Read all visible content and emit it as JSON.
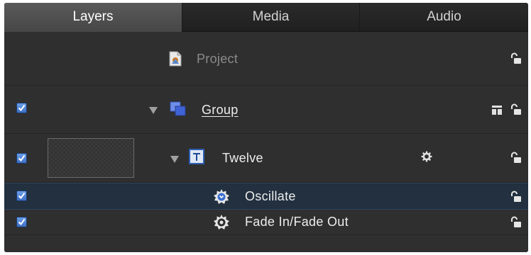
{
  "tabs": [
    {
      "label": "Layers",
      "active": true
    },
    {
      "label": "Media",
      "active": false
    },
    {
      "label": "Audio",
      "active": false
    }
  ],
  "layers": {
    "project": {
      "label": "Project",
      "icon": "project-file-icon",
      "locked": false
    },
    "group": {
      "label": "Group",
      "checked": true,
      "expanded": true,
      "icon": "group-icon",
      "locked": false
    },
    "twelve": {
      "label": "Twelve",
      "checked": true,
      "expanded": true,
      "icon": "text-layer-icon",
      "locked": false
    },
    "oscillate": {
      "label": "Oscillate",
      "checked": true,
      "selected": true,
      "icon": "behavior-gear-icon",
      "locked": false
    },
    "fade": {
      "label": "Fade In/Fade Out",
      "checked": true,
      "selected": false,
      "icon": "behavior-gear-icon",
      "locked": false
    }
  },
  "colors": {
    "panel_bg": "#2e2e2e",
    "selected_row": "#22303f",
    "checkbox_blue": "#4a7fd4",
    "active_tab": "#505050"
  }
}
